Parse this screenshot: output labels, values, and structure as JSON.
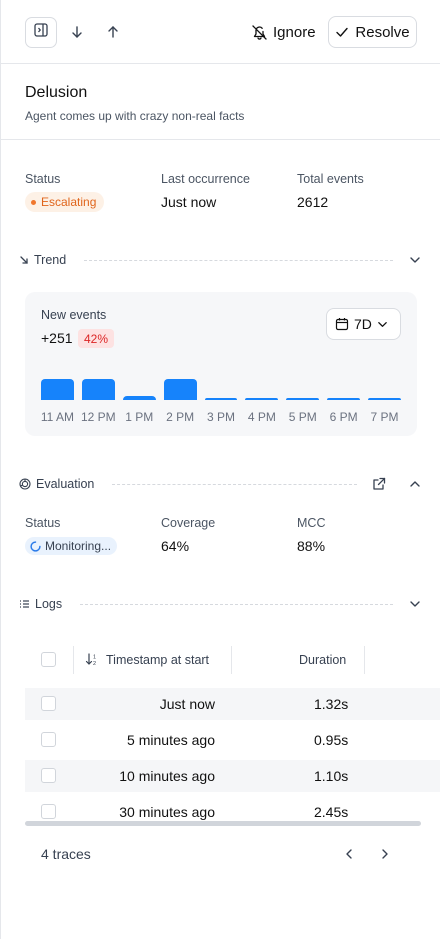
{
  "toolbar": {
    "sidebar_icon": "sidebar-toggle-icon",
    "ignore_label": "Ignore",
    "resolve_label": "Resolve"
  },
  "issue": {
    "title": "Delusion",
    "description": "Agent comes up with crazy non-real facts"
  },
  "stats": {
    "status_label": "Status",
    "status_value": "Escalating",
    "last_label": "Last occurrence",
    "last_value": "Just now",
    "total_label": "Total events",
    "total_value": "2612"
  },
  "trend": {
    "section_label": "Trend",
    "card_label": "New events",
    "delta": "+251",
    "delta_pct": "42%",
    "range": "7D",
    "chart_data": {
      "type": "bar",
      "categories": [
        "11 AM",
        "12 PM",
        "1 PM",
        "2 PM",
        "3 PM",
        "4 PM",
        "5 PM",
        "6 PM",
        "7 PM"
      ],
      "values": [
        10,
        10,
        2,
        10,
        1,
        1,
        1,
        1,
        1
      ],
      "title": "",
      "xlabel": "",
      "ylabel": "",
      "color": "#1683fb"
    }
  },
  "evaluation": {
    "section_label": "Evaluation",
    "status_label": "Status",
    "status_value": "Monitoring...",
    "coverage_label": "Coverage",
    "coverage_value": "64%",
    "mcc_label": "MCC",
    "mcc_value": "88%"
  },
  "logs": {
    "section_label": "Logs",
    "columns": [
      "Timestamp at start",
      "Duration"
    ],
    "rows": [
      {
        "timestamp": "Just now",
        "duration": "1.32s"
      },
      {
        "timestamp": "5 minutes ago",
        "duration": "0.95s"
      },
      {
        "timestamp": "10 minutes ago",
        "duration": "1.10s"
      },
      {
        "timestamp": "30 minutes ago",
        "duration": "2.45s"
      }
    ],
    "footer": "4 traces"
  },
  "colors": {
    "accent": "#1683fb",
    "escalating": "#e0651c",
    "danger": "#dc2626"
  }
}
